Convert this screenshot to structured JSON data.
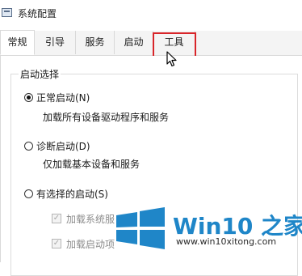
{
  "window": {
    "title": "系统配置"
  },
  "tabs": [
    {
      "label": "常规",
      "active": true
    },
    {
      "label": "引导",
      "active": false
    },
    {
      "label": "服务",
      "active": false
    },
    {
      "label": "启动",
      "active": false
    },
    {
      "label": "工具",
      "active": false,
      "highlighted": true
    }
  ],
  "startup": {
    "group_label": "启动选择",
    "options": [
      {
        "label": "正常启动(N)",
        "desc": "加载所有设备驱动程序和服务",
        "selected": true
      },
      {
        "label": "诊断启动(D)",
        "desc": "仅加载基本设备和服务",
        "selected": false
      },
      {
        "label": "有选择的启动(S)",
        "selected": false
      }
    ],
    "checkboxes": [
      {
        "label": "加载系统服",
        "checked": true,
        "enabled": false
      },
      {
        "label": "加载启动项",
        "checked": true,
        "enabled": false
      }
    ]
  },
  "watermark": {
    "title": "Win10 之家",
    "url": "www.win10xitong.com"
  },
  "colors": {
    "highlight": "#d8252a",
    "watermark_blue": "#1f86c8"
  }
}
